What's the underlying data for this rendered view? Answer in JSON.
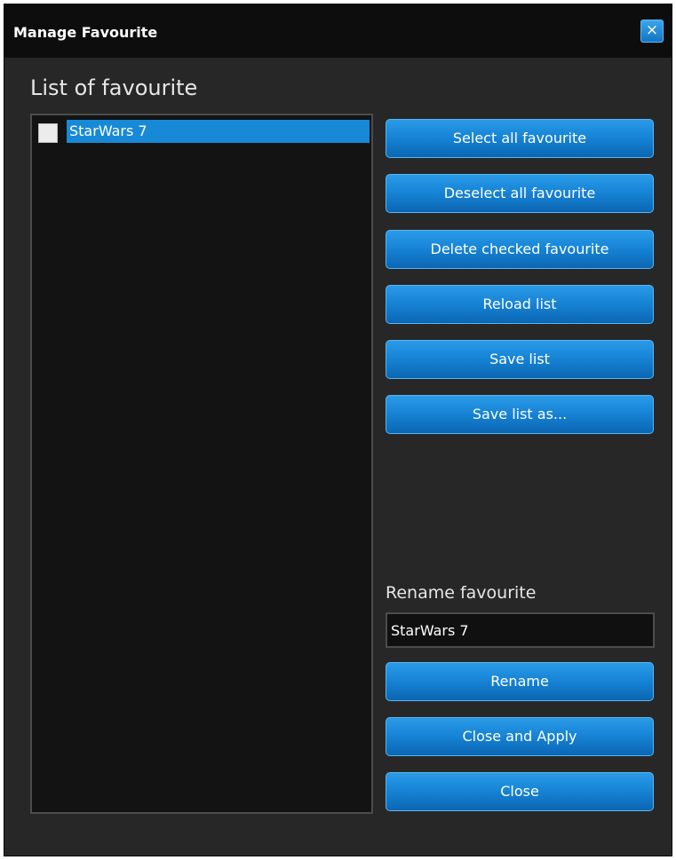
{
  "window": {
    "title": "Manage Favourite",
    "close_symbol": "×"
  },
  "list": {
    "heading": "List of favourite",
    "items": [
      {
        "label": "StarWars 7",
        "checked": false,
        "selected": true
      }
    ]
  },
  "actions": {
    "select_all": "Select all favourite",
    "deselect_all": "Deselect all favourite",
    "delete_checked": "Delete checked favourite",
    "reload": "Reload list",
    "save": "Save list",
    "save_as": "Save list as..."
  },
  "rename": {
    "label": "Rename favourite",
    "value": "StarWars 7",
    "button": "Rename"
  },
  "footer": {
    "close_apply": "Close and Apply",
    "close": "Close"
  },
  "colors": {
    "accent": "#1889d6",
    "window_bg": "#272727",
    "titlebar_bg": "#0d0d0d",
    "list_bg": "#131313"
  },
  "icons": {
    "window_close": "close-icon",
    "item_checkbox": "checkbox-icon"
  }
}
